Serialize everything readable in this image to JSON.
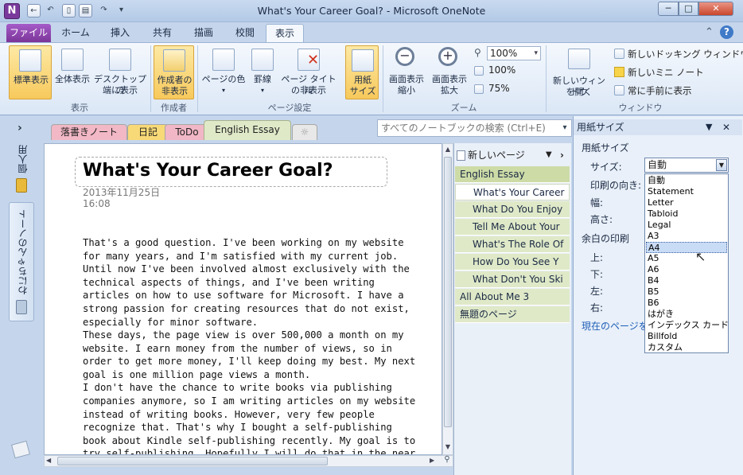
{
  "window": {
    "title": "What's Your Career Goal? - Microsoft OneNote",
    "app_icon": "N",
    "controls": [
      "─",
      "□",
      "✕"
    ]
  },
  "qat": {
    "back": "←",
    "undo": "↶",
    "dock": "▯",
    "page": "▤",
    "redo": "↷",
    "more": "▾"
  },
  "ribbon_tabs": {
    "file": "ファイル",
    "home": "ホーム",
    "insert": "挿入",
    "share": "共有",
    "draw": "描画",
    "review": "校閲",
    "view": "表示"
  },
  "ribbon": {
    "normal_view": "標準表示",
    "full_page_view": "全体表示",
    "dock_to_desktop": [
      "デスクトップの",
      "端に表示"
    ],
    "hide_authors": [
      "作成者の",
      "非表示"
    ],
    "page_color": "ページの色",
    "rule_lines": "罫線",
    "hide_page_title": [
      "ページ タイトル",
      "の非表示"
    ],
    "paper_size": [
      "用紙",
      "サイズ"
    ],
    "zoom_out": [
      "画面表示",
      "縮小"
    ],
    "zoom_in": [
      "画面表示",
      "拡大"
    ],
    "zoom_value": "100%",
    "zoom_100": "100%",
    "zoom_75": "75%",
    "new_window": [
      "新しいウィンドウ",
      "を開く"
    ],
    "new_docked_window": "新しいドッキング ウィンドウ",
    "new_mini_note": "新しいミニ ノート",
    "always_on_top": "常に手前に表示",
    "groups": {
      "views": "表示",
      "authors": "作成者",
      "page_setup": "ページ設定",
      "zoom": "ズーム",
      "window": "ウィンドウ"
    }
  },
  "sections": [
    {
      "label": "落書きノート",
      "color": "#f2b8c6"
    },
    {
      "label": "日記",
      "color": "#f8d977"
    },
    {
      "label": "ToDo",
      "color": "#f1b7c6"
    },
    {
      "label": "English Essay",
      "color": "#dfe9c8"
    },
    {
      "label": "☼",
      "color": "#e8e8e8"
    }
  ],
  "search": {
    "placeholder": "すべてのノートブックの検索 (Ctrl+E)"
  },
  "navigation": {
    "collapse": "›",
    "notebook_personal": "個人用",
    "notebook_shared": "わにちゃんのノート"
  },
  "page": {
    "title": "What's Your Career Goal?",
    "date": "2013年11月25日",
    "time": "16:08",
    "paragraph1": "That's a good question. I've been working  on my website for many  years, and I'm  satisfied with my  current job. Until now I've been involved almost  exclusively with the technical aspects of things, and I've been writing  articles on how to use software for Microsoft. I have a strong passion  for creating resources that do not exist, especially for minor  software.",
    "paragraph2": "These days, the page view is over 500,000  a month on my website. I earn money  from  the number  of views, so in order to get more  money, I'll keep doing my best. My next goal is one million  page views a month.",
    "paragraph3": "I don't have the chance to write books  via publishing companies anymore, so I am  writing  articles on my website instead of writing books. However, very few people recognize that. That's why I bought a self-publishing book about Kindle  self-publishing recently. My goal is to try self-publishing.  Hopefully I will do that in the near future."
  },
  "pages_list": {
    "new_page": "新しいページ",
    "items": [
      "English Essay",
      "What's Your Career",
      "What Do You Enjoy",
      "Tell Me About Your",
      "What's The Role Of",
      "How Do You See Y",
      "What Don't You Ski",
      "All About Me 3",
      "無題のページ"
    ],
    "selected_index": 1
  },
  "paper_pane": {
    "title": "用紙サイズ",
    "section_label": "用紙サイズ",
    "size_label": "サイズ:",
    "size_value": "自動",
    "orientation_label": "印刷の向き:",
    "width_label": "幅:",
    "height_label": "高さ:",
    "margins_label": "余白の印刷",
    "top_label": "上:",
    "bottom_label": "下:",
    "left_label": "左:",
    "right_label": "右:",
    "save_link": "現在のページをテ",
    "options": [
      "自動",
      "Statement",
      "Letter",
      "Tabloid",
      "Legal",
      "A3",
      "A4",
      "A5",
      "A6",
      "B4",
      "B5",
      "B6",
      "はがき",
      "インデックス カード",
      "Billfold",
      "カスタム"
    ],
    "highlighted_option": "A4"
  },
  "colors": {
    "accent_file_tab": "#7b3598",
    "selected_button": "#f7c95c",
    "ribbon_bg": "#dbe7f6",
    "dropdown_highlight": "#c9dcf5"
  }
}
